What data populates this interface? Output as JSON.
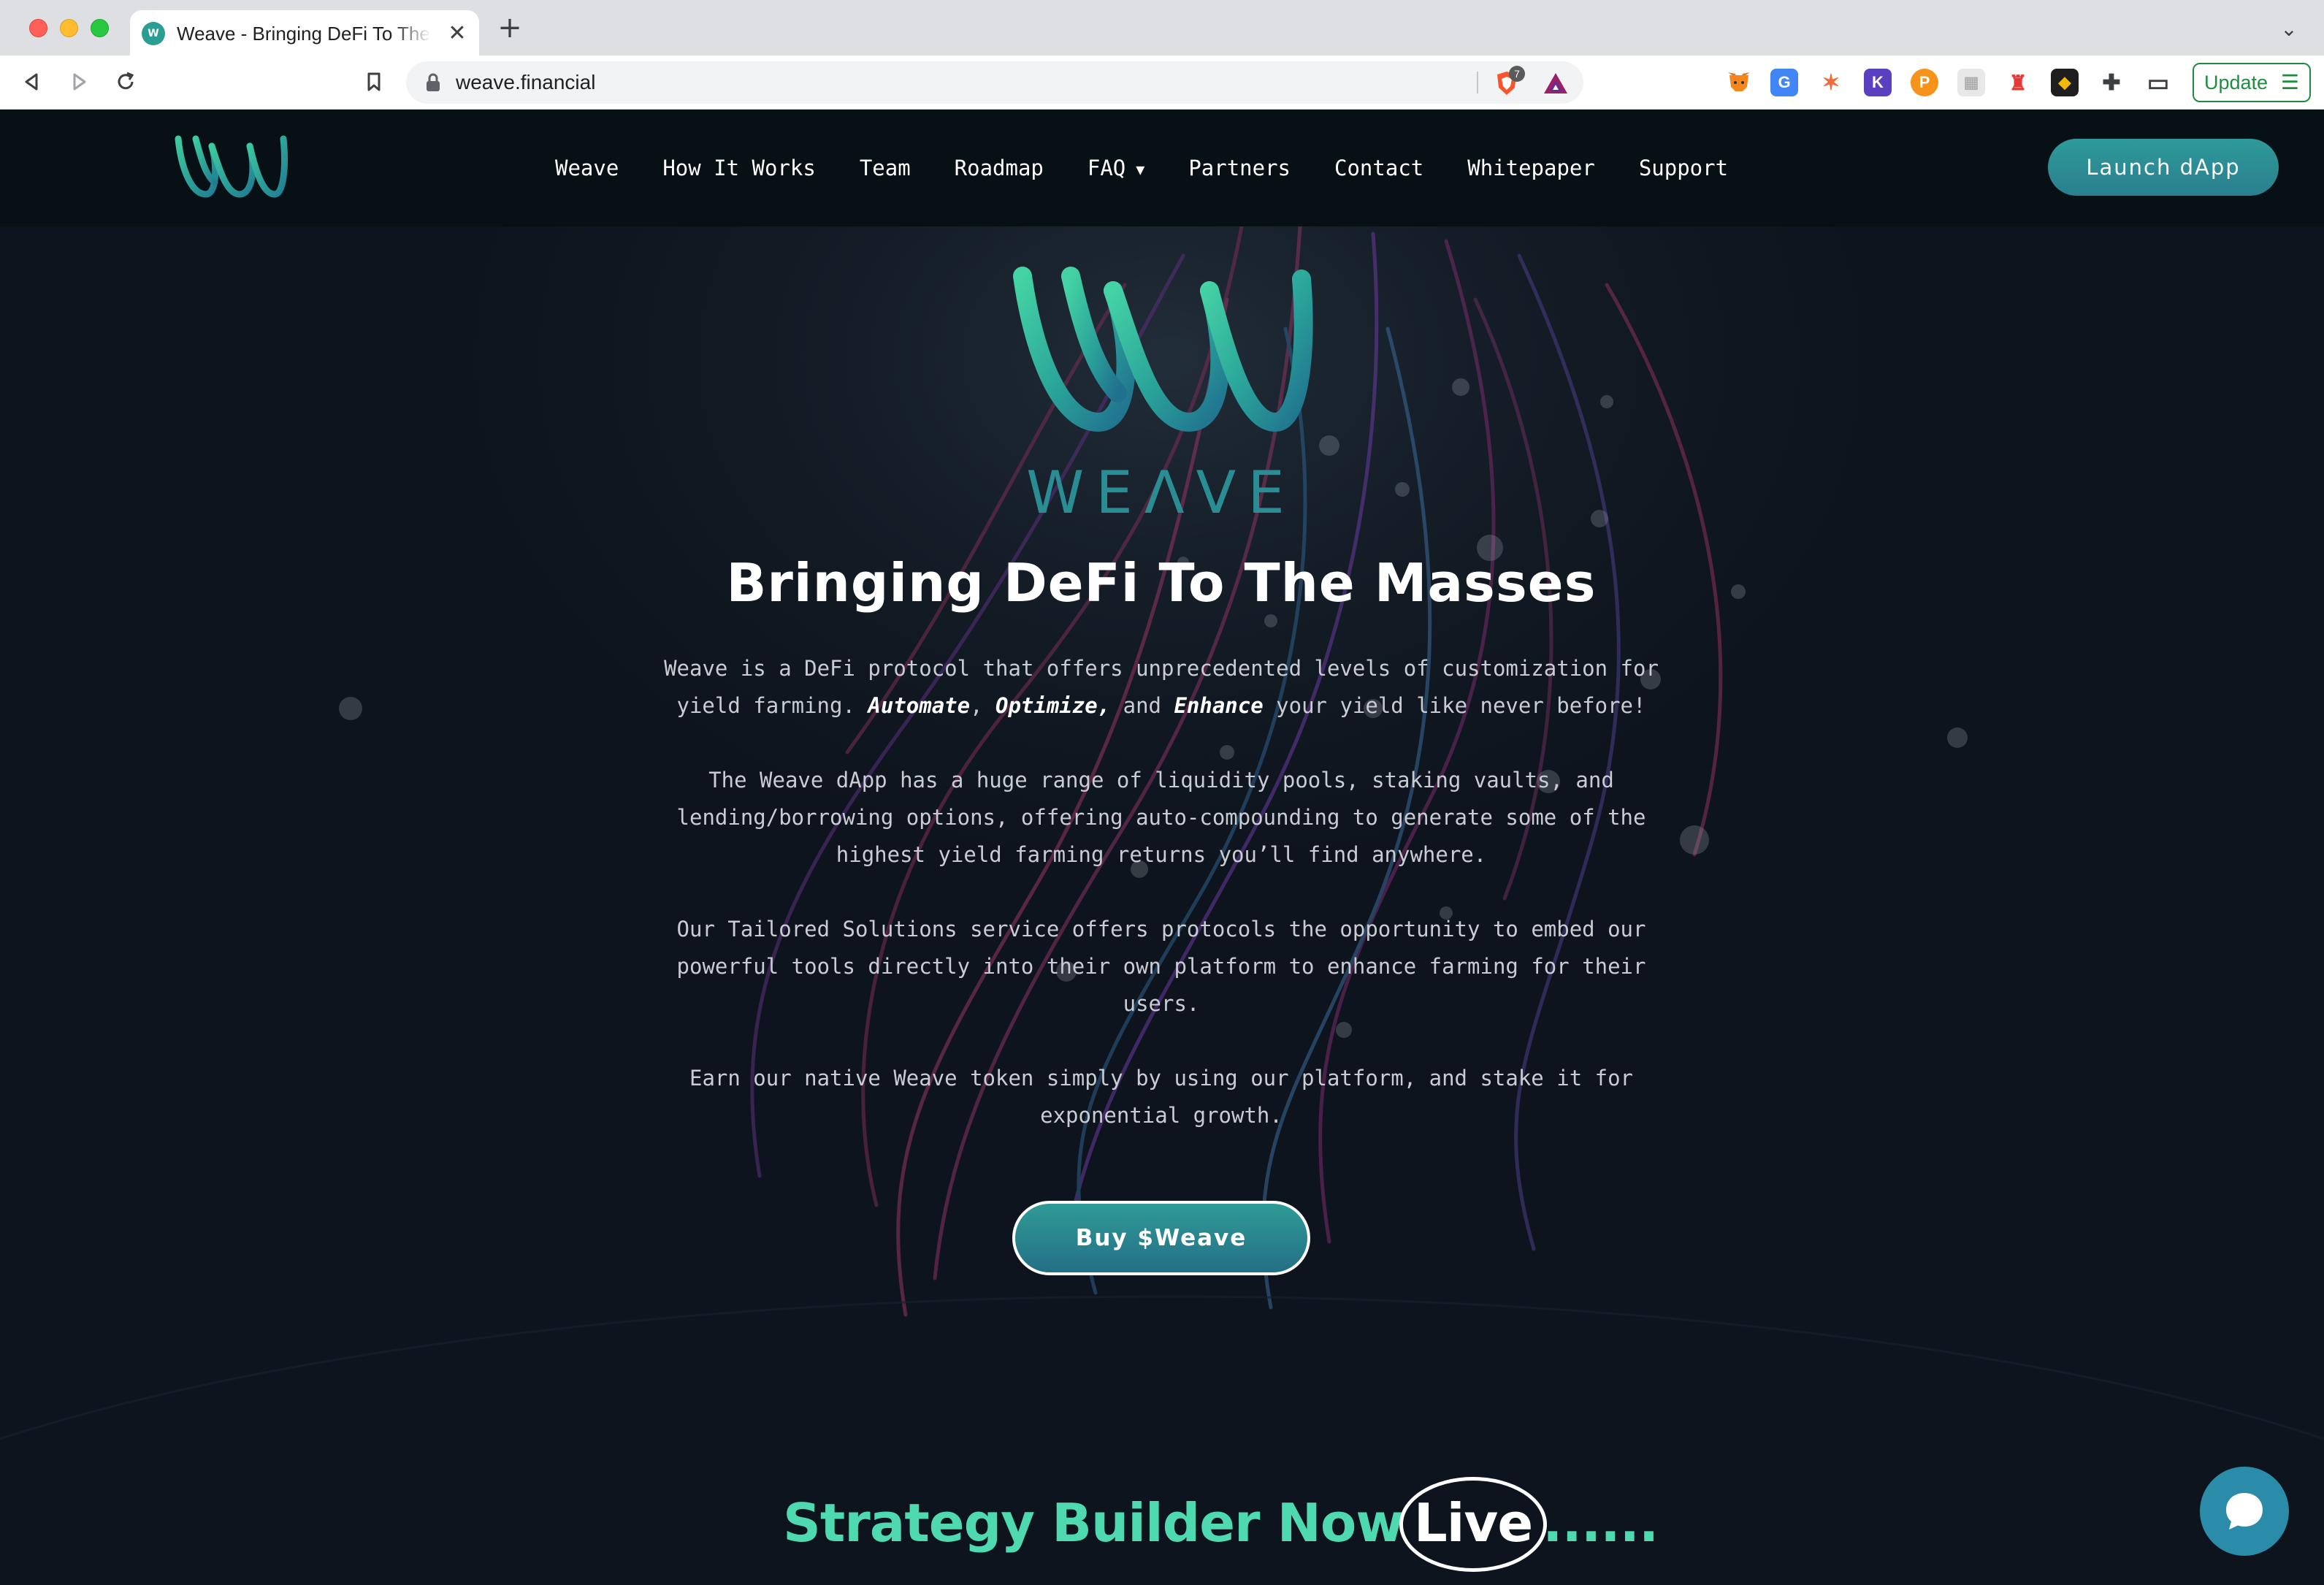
{
  "browser": {
    "tab_title": "Weave - Bringing DeFi To The Masses",
    "tab_favicon_text": "W",
    "new_tab_symbol": "+",
    "close_symbol": "✕",
    "url": "weave.financial",
    "brave_shield_count": "7",
    "update_label": "Update",
    "update_menu_symbol": "☰",
    "extensions": [
      "metamask-icon",
      "translate-icon",
      "stars-icon",
      "k-extension-icon",
      "p-extension-icon",
      "grid-extension-icon",
      "lighthouse-icon",
      "binance-icon",
      "puzzle-icon",
      "wallet-icon"
    ],
    "extension_glyphs": {
      "translate": "G",
      "stars": "✶",
      "k": "K",
      "p": "P",
      "grid": "▦",
      "lighthouse": "♜",
      "binance": "◆",
      "puzzle": "✚",
      "wallet": "▭"
    }
  },
  "nav": {
    "links": [
      {
        "label": "Weave"
      },
      {
        "label": "How It Works"
      },
      {
        "label": "Team"
      },
      {
        "label": "Roadmap"
      },
      {
        "label": "FAQ"
      },
      {
        "label": "Partners"
      },
      {
        "label": "Contact"
      },
      {
        "label": "Whitepaper"
      },
      {
        "label": "Support"
      }
    ],
    "faq_caret": "▼",
    "launch_label": "Launch dApp"
  },
  "hero": {
    "wordmark": "WEΛVE",
    "title": "Bringing DeFi To The Masses",
    "p1_before": "Weave is a DeFi protocol that offers unprecedented levels of customization for yield farming. ",
    "p1_automate": "Automate",
    "p1_comma1": ", ",
    "p1_optimize": "Optimize,",
    "p1_and": " and ",
    "p1_enhance": "Enhance",
    "p1_after": " your yield like never before!",
    "p2": "The Weave dApp has a huge range of liquidity pools, staking vaults, and lending/borrowing options, offering auto-compounding to generate some of the highest yield farming returns you’ll find anywhere.",
    "p3": "Our Tailored Solutions service offers protocols the opportunity to embed our powerful tools directly into their own platform to enhance farming for their users.",
    "p4": "Earn our native Weave token simply by using our platform, and stake it for exponential growth.",
    "buy_label": "Buy $Weave"
  },
  "strategy": {
    "main": "Strategy Builder Now",
    "live": "Live",
    "dots": "......"
  },
  "colors": {
    "accent_teal": "#2a9d95",
    "headline_green": "#4fd9b0",
    "page_bg": "#0d141d",
    "nav_bg": "#071015"
  }
}
